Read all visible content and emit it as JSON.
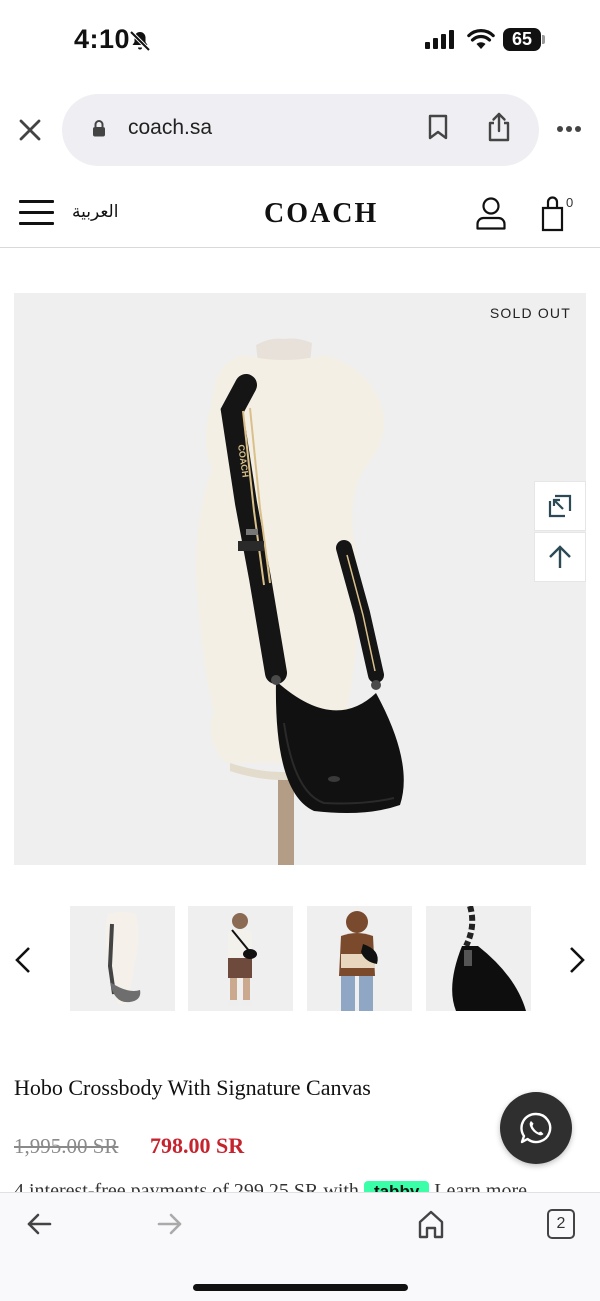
{
  "status_bar": {
    "time": "4:10",
    "battery_level": "65",
    "icons": [
      "bell-slash-icon",
      "signal-icon",
      "wifi-icon",
      "battery-icon"
    ]
  },
  "browser": {
    "url": "coach.sa",
    "icons": [
      "close-icon",
      "lock-icon",
      "bookmark-icon",
      "share-icon",
      "more-icon"
    ]
  },
  "site_header": {
    "language_link": "العربية",
    "logo": "COACH",
    "bag_count": "0",
    "icons": [
      "menu-icon",
      "account-icon",
      "shopping-bag-icon"
    ]
  },
  "product": {
    "badge": "SOLD OUT",
    "strap_text": "COACH",
    "title": "Hobo Crossbody With Signature Canvas",
    "original_price": "1,995.00 SR",
    "sale_price": "798.00 SR",
    "installment_text": "4 interest-free payments of 299.25 SR  with",
    "tabby_label": "tabby",
    "learn_more": "Learn more",
    "thumbnails": [
      "mannequin-view",
      "model-front-view",
      "model-side-view",
      "detail-view"
    ]
  },
  "floating_buttons": [
    "expand-icon",
    "scroll-top-icon",
    "whatsapp-icon"
  ],
  "toolbar": {
    "tabs_count": "2",
    "icons": [
      "back-icon",
      "forward-icon",
      "home-icon",
      "tabs-icon"
    ]
  },
  "colors": {
    "sale_price": "#c5232d",
    "tabby_green": "#3bffa8",
    "image_background": "#efefef",
    "whatsapp_button": "#2f2f2f"
  }
}
